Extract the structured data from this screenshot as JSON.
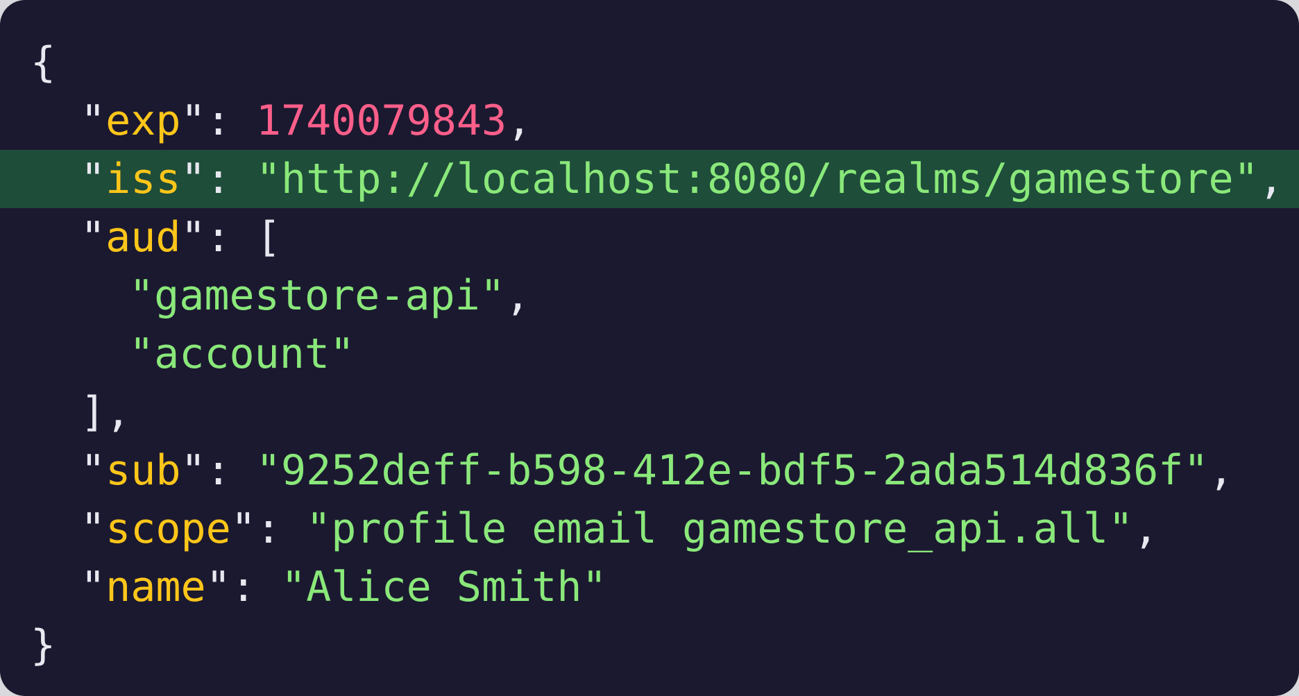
{
  "open_brace": "{",
  "close_brace": "}",
  "quote": "\"",
  "colon": ": ",
  "comma": ",",
  "fields": {
    "exp": {
      "key": "exp",
      "value": "1740079843"
    },
    "iss": {
      "key": "iss",
      "value": "http://localhost:8080/realms/gamestore"
    },
    "aud": {
      "key": "aud",
      "open": "[",
      "close": "],",
      "items": [
        "gamestore-api",
        "account"
      ]
    },
    "sub": {
      "key": "sub",
      "value": "9252deff-b598-412e-bdf5-2ada514d836f"
    },
    "scope": {
      "key": "scope",
      "value": "profile email gamestore_api.all"
    },
    "name": {
      "key": "name",
      "value": "Alice Smith"
    }
  },
  "highlighted_line": "iss",
  "colors": {
    "background": "#1b1930",
    "highlight": "#1e4d3a",
    "key": "#ffc61a",
    "string": "#8ae87a",
    "number": "#ff5f8a",
    "punctuation": "#e8e8f0"
  }
}
